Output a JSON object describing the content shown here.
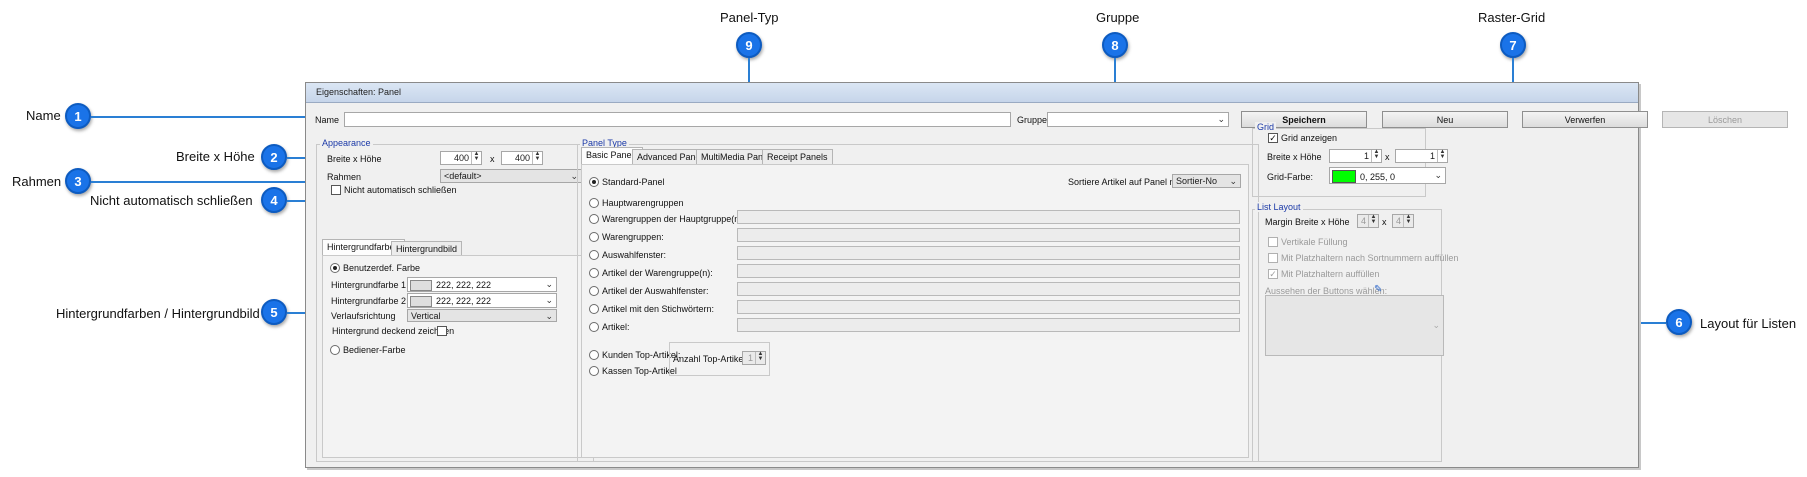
{
  "callouts": {
    "panel_typ": {
      "number": "9",
      "label": "Panel-Typ"
    },
    "gruppe": {
      "number": "8",
      "label": "Gruppe"
    },
    "raster_grid": {
      "number": "7",
      "label": "Raster-Grid"
    },
    "name": {
      "number": "1",
      "label": "Name"
    },
    "breite_hoehe": {
      "number": "2",
      "label": "Breite x Höhe"
    },
    "rahmen": {
      "number": "3",
      "label": "Rahmen"
    },
    "nicht_auto": {
      "number": "4",
      "label": "Nicht automatisch schließen"
    },
    "hintergrund": {
      "number": "5",
      "label": "Hintergrundfarben / Hintergrundbild"
    },
    "layout_listen": {
      "number": "6",
      "label": "Layout für Listen"
    }
  },
  "window": {
    "title": "Eigenschaften: Panel"
  },
  "toolbar": {
    "name_label": "Name",
    "name_value": "",
    "gruppe_label": "Gruppe",
    "gruppe_value": "",
    "save": "Speichern",
    "new": "Neu",
    "discard": "Verwerfen",
    "delete": "Löschen"
  },
  "appearance": {
    "title": "Appearance",
    "size_label": "Breite x Höhe",
    "width": "400",
    "height": "400",
    "x": "x",
    "frame_label": "Rahmen",
    "frame_value": "<default>",
    "no_autoclose_label": "Nicht automatisch schließen",
    "no_autoclose_checked": false
  },
  "background": {
    "tabs": [
      "Hintergrundfarben",
      "Hintergrundbild"
    ],
    "custom_color_label": "Benutzerdef. Farbe",
    "color1_label": "Hintergrundfarbe 1",
    "color1_value": "222, 222, 222",
    "color2_label": "Hintergrundfarbe 2",
    "color2_value": "222, 222, 222",
    "swatch_color": "#dedede",
    "gradient_label": "Verlaufsrichtung",
    "gradient_value": "Vertical",
    "opaque_label": "Hintergrund deckend zeichnen",
    "operator_color_label": "Bediener-Farbe"
  },
  "panel_type": {
    "title": "Panel Type",
    "tabs": [
      "Basic Panels",
      "Advanced Panels",
      "MultiMedia Panels",
      "Receipt Panels"
    ],
    "sort_label": "Sortiere Artikel auf Panel nach",
    "sort_value": "Sortier-No",
    "options": [
      "Standard-Panel",
      "Hauptwarengruppen",
      "Warengruppen der Hauptgruppe(n):",
      "Warengruppen:",
      "Auswahlfenster:",
      "Artikel der Warengruppe(n):",
      "Artikel der Auswahlfenster:",
      "Artikel mit den Stichwörtern:",
      "Artikel:"
    ],
    "top_options": [
      "Kunden Top-Artikel:",
      "Kassen Top-Artikel"
    ],
    "top_count_label": "Anzahl Top-Artikel",
    "top_count_value": "1"
  },
  "grid": {
    "title": "Grid",
    "show_label": "Grid anzeigen",
    "show_checked": true,
    "size_label": "Breite x Höhe",
    "width": "1",
    "height": "1",
    "x": "x",
    "color_label": "Grid-Farbe:",
    "color_value": "0, 255, 0",
    "color_hex": "#00ff00"
  },
  "list_layout": {
    "title": "List Layout",
    "margin_label": "Margin Breite x Höhe",
    "margin_w": "4",
    "margin_h": "4",
    "x": "x",
    "vertical_fill": "Vertikale Füllung",
    "fill_by_sort": "Mit Platzhaltern nach Sortnummern auffüllen",
    "fill_placeholders": "Mit Platzhaltern auffüllen",
    "button_look_label": "Aussehen der Buttons wählen:"
  }
}
